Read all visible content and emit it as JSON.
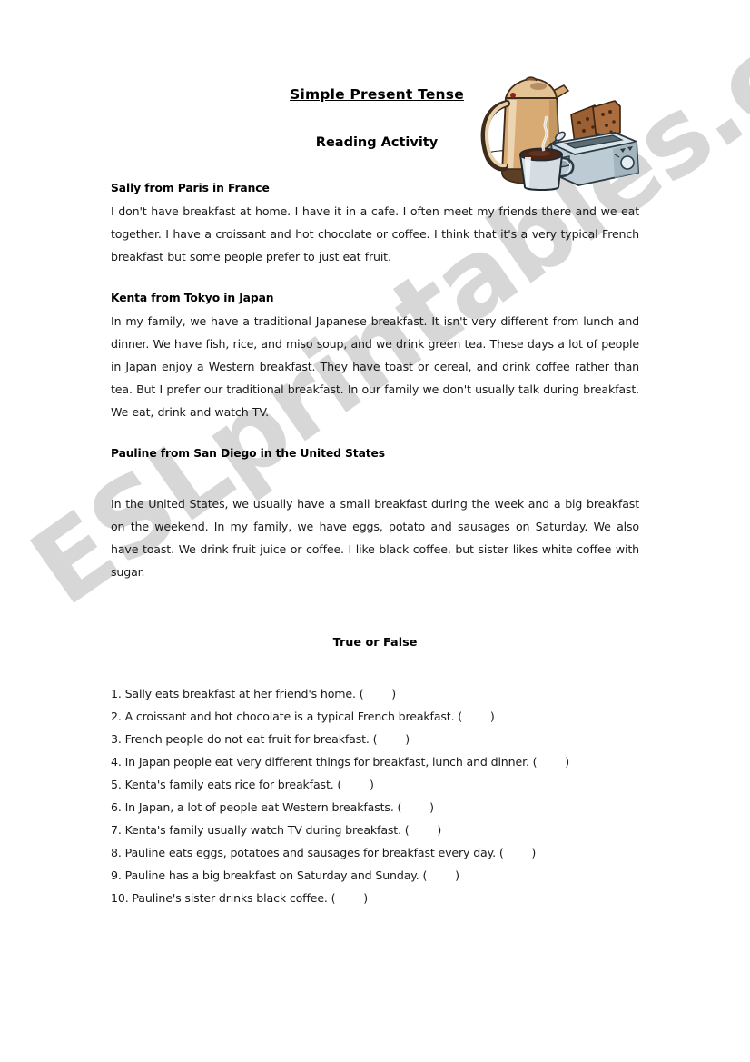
{
  "header": {
    "title": "Simple Present Tense",
    "subtitle": "Reading Activity",
    "clipart_name": "breakfast-coffee-pot-toaster-mug"
  },
  "watermark": {
    "text": "ESLprintables.com"
  },
  "sections": [
    {
      "heading": "Sally from Paris in France",
      "body": "I don't have breakfast at home.    I have it in a cafe.    I often meet my friends there and we eat together.    I have a croissant and hot chocolate or coffee.    I think that it's a very typical French breakfast but some people prefer to just eat fruit."
    },
    {
      "heading": "Kenta from Tokyo in Japan",
      "body": "In my family, we have a traditional Japanese breakfast.    It isn't very different from lunch and dinner.    We have fish, rice, and miso soup, and we drink green tea. These days a lot of people in Japan enjoy a Western breakfast.    They have toast or cereal, and drink coffee rather than tea.    But I prefer our traditional breakfast.    In our family we don't usually talk during breakfast.    We eat, drink and watch TV."
    },
    {
      "heading": "Pauline from San Diego in the United States",
      "body": "In the United States, we usually have a small breakfast during the week and a big breakfast on the weekend.    In my family, we have eggs, potato and sausages on Saturday. We also have toast.    We drink fruit juice or coffee.    I like black coffee. but sister likes white coffee with sugar."
    }
  ],
  "true_or_false": {
    "heading": "True or False",
    "questions": [
      "1. Sally eats breakfast at her friend's home. (        )",
      "2. A croissant and hot chocolate is a typical French breakfast. (        )",
      "3. French people do not eat fruit for breakfast. (        )",
      "4. In Japan people eat very different things for breakfast, lunch and dinner. (        )",
      "5. Kenta's family eats rice for breakfast. (        )",
      "6. In Japan, a lot of people eat Western breakfasts. (        )",
      "7. Kenta's family usually watch TV during breakfast. (        )",
      "8. Pauline eats eggs, potatoes and sausages for breakfast every day. (        )",
      "9. Pauline has a big breakfast on Saturday and Sunday. (        )",
      "10. Pauline's sister drinks black coffee. (        )"
    ]
  },
  "colors": {
    "page_background": "#ffffff",
    "text": "#1a1a1a",
    "heading": "#000000",
    "watermark": "#969696",
    "coffee_pot_body": "#d9ab74",
    "coffee_pot_outline": "#4a3524",
    "toaster_body": "#bccbd4",
    "toast": "#9a5f33",
    "mug_body": "#d6dde0",
    "coffee_liquid": "#4a2416"
  }
}
